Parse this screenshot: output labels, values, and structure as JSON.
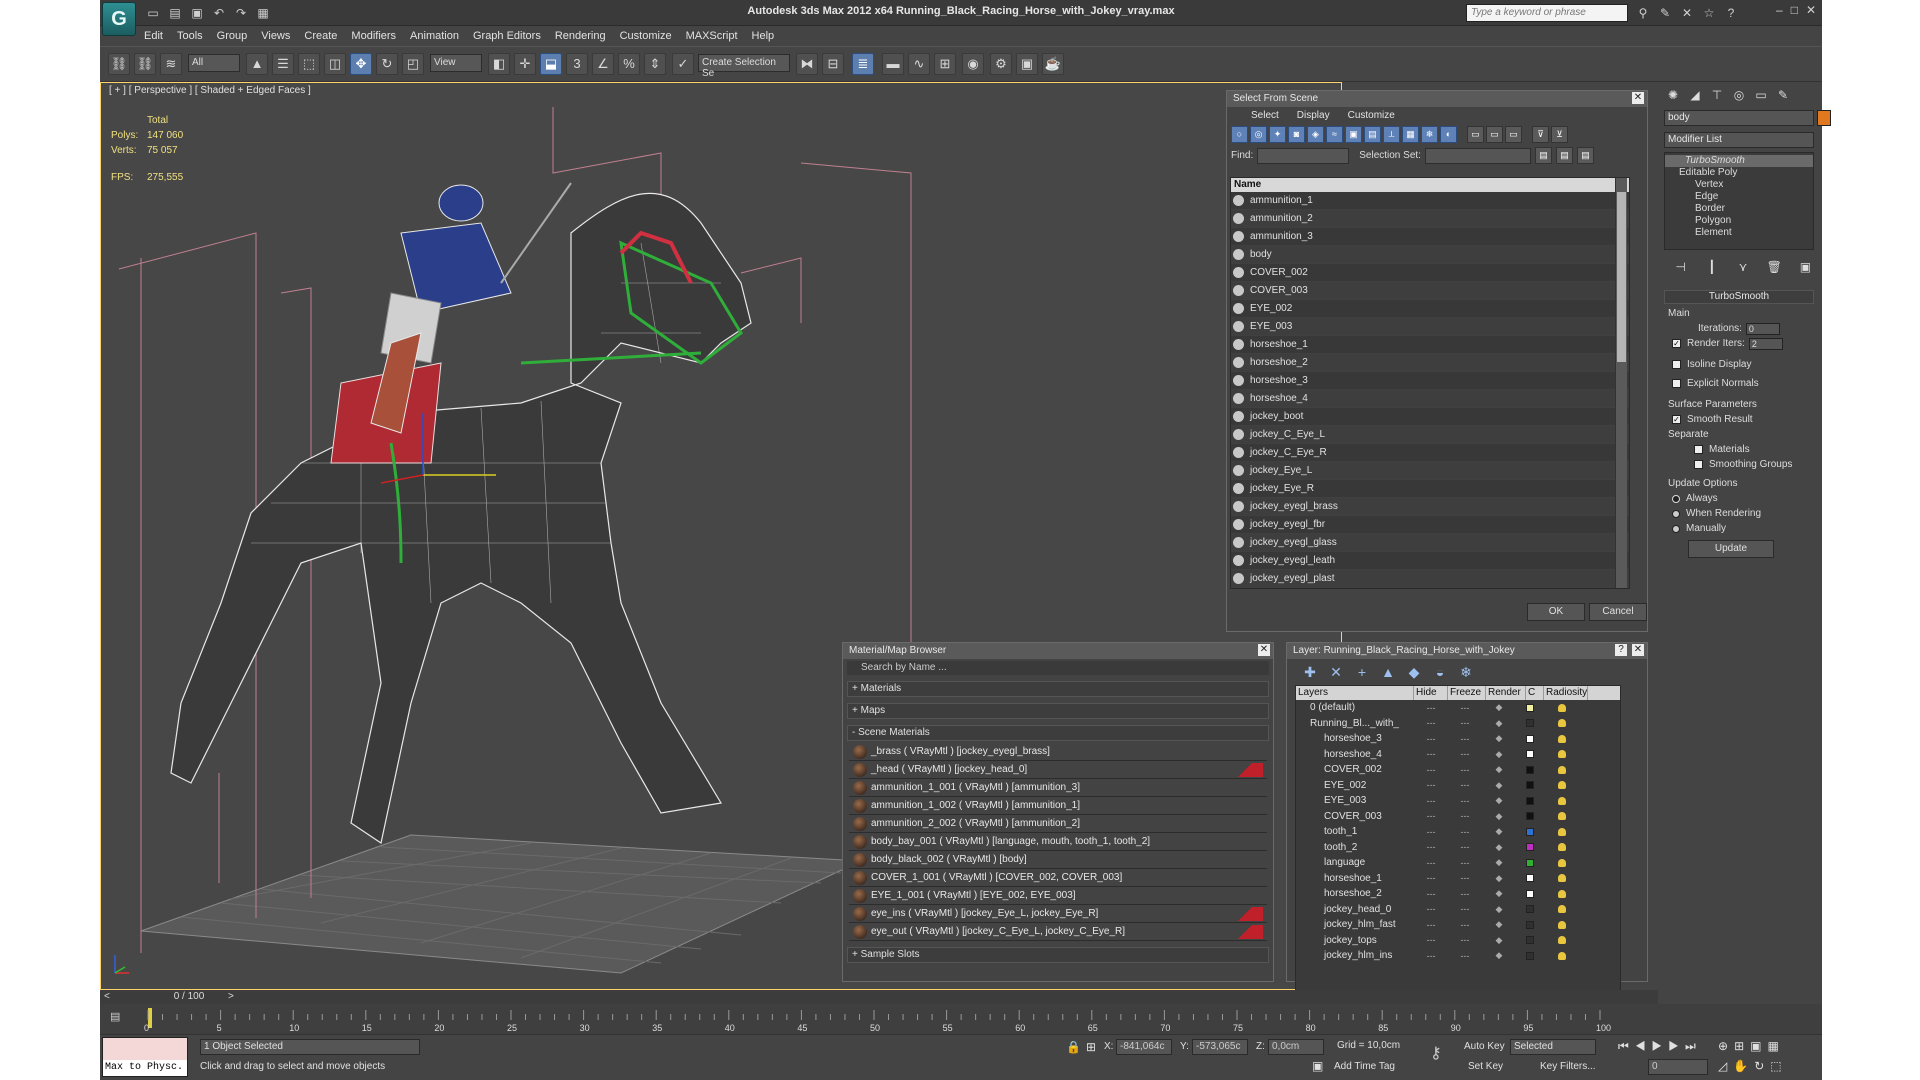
{
  "window": {
    "title": "Autodesk 3ds Max  2012 x64      Running_Black_Racing_Horse_with_Jokey_vray.max",
    "search_placeholder": "Type a keyword or phrase",
    "logo": "G"
  },
  "menu": [
    "Edit",
    "Tools",
    "Group",
    "Views",
    "Create",
    "Modifiers",
    "Animation",
    "Graph Editors",
    "Rendering",
    "Customize",
    "MAXScript",
    "Help"
  ],
  "toolbar": {
    "selection_filter": "All",
    "ref_coord": "View",
    "named_selection": "Create Selection Se"
  },
  "viewport": {
    "label": "[ + ] [ Perspective ] [ Shaded + Edged Faces ]",
    "stats": {
      "total_label": "Total",
      "polys_label": "Polys:",
      "polys_value": "147 060",
      "verts_label": "Verts:",
      "verts_value": "75 057",
      "fps_label": "FPS:",
      "fps_value": "275,555"
    }
  },
  "select_from_scene": {
    "title": "Select From Scene",
    "menu": [
      "Select",
      "Display",
      "Customize"
    ],
    "find_label": "Find:",
    "selection_set_label": "Selection Set:",
    "column_name": "Name",
    "items": [
      "ammunition_1",
      "ammunition_2",
      "ammunition_3",
      "body",
      "COVER_002",
      "COVER_003",
      "EYE_002",
      "EYE_003",
      "horseshoe_1",
      "horseshoe_2",
      "horseshoe_3",
      "horseshoe_4",
      "jockey_boot",
      "jockey_C_Eye_L",
      "jockey_C_Eye_R",
      "jockey_Eye_L",
      "jockey_Eye_R",
      "jockey_eyegl_brass",
      "jockey_eyegl_fbr",
      "jockey_eyegl_glass",
      "jockey_eyegl_leath",
      "jockey_eyegl_plast"
    ],
    "ok": "OK",
    "cancel": "Cancel"
  },
  "material_browser": {
    "title": "Material/Map Browser",
    "search_placeholder": "Search by Name ...",
    "section_materials": "+ Materials",
    "section_maps": "+ Maps",
    "section_scene": "- Scene Materials",
    "section_slots": "+ Sample Slots",
    "items": [
      "_brass  ( VRayMtl ) [jockey_eyegl_brass]",
      "_head  ( VRayMtl ) [jockey_head_0]",
      "ammunition_1_001  ( VRayMtl ) [ammunition_3]",
      "ammunition_1_002  ( VRayMtl ) [ammunition_1]",
      "ammunition_2_002  ( VRayMtl ) [ammunition_2]",
      "body_bay_001  ( VRayMtl ) [language, mouth, tooth_1, tooth_2]",
      "body_black_002  ( VRayMtl ) [body]",
      "COVER_1_001  ( VRayMtl ) [COVER_002, COVER_003]",
      "EYE_1_001  ( VRayMtl ) [EYE_002, EYE_003]",
      "eye_ins  ( VRayMtl ) [jockey_Eye_L, jockey_Eye_R]",
      "eye_out  ( VRayMtl ) [jockey_C_Eye_L, jockey_C_Eye_R]"
    ]
  },
  "layer_manager": {
    "title": "Layer: Running_Black_Racing_Horse_with_Jokey",
    "help": "?",
    "columns": [
      "Layers",
      "Hide",
      "Freeze",
      "Render",
      "C",
      "Radiosity"
    ],
    "rows": [
      {
        "name": "0 (default)",
        "color": "#f0f0a0"
      },
      {
        "name": "Running_Bl..._with_",
        "color": "#303030"
      },
      {
        "name": "horseshoe_3",
        "color": "#ffffff"
      },
      {
        "name": "horseshoe_4",
        "color": "#ffffff"
      },
      {
        "name": "COVER_002",
        "color": "#101010"
      },
      {
        "name": "EYE_002",
        "color": "#101010"
      },
      {
        "name": "EYE_003",
        "color": "#101010"
      },
      {
        "name": "COVER_003",
        "color": "#101010"
      },
      {
        "name": "tooth_1",
        "color": "#3070d0"
      },
      {
        "name": "tooth_2",
        "color": "#c030c0"
      },
      {
        "name": "language",
        "color": "#30b030"
      },
      {
        "name": "horseshoe_1",
        "color": "#ffffff"
      },
      {
        "name": "horseshoe_2",
        "color": "#ffffff"
      },
      {
        "name": "jockey_head_0",
        "color": "#303030"
      },
      {
        "name": "jockey_hlm_fast",
        "color": "#303030"
      },
      {
        "name": "jockey_tops",
        "color": "#303030"
      },
      {
        "name": "jockey_hlm_ins",
        "color": "#303030"
      }
    ]
  },
  "command_panel": {
    "object_name": "body",
    "modifier_list": "Modifier List",
    "stack": [
      "TurboSmooth",
      "Editable Poly",
      "Vertex",
      "Edge",
      "Border",
      "Polygon",
      "Element"
    ],
    "turbosmooth_title": "TurboSmooth",
    "main_label": "Main",
    "iterations_label": "Iterations:",
    "iterations_value": "0",
    "render_iters_label": "Render Iters:",
    "render_iters_value": "2",
    "isoline": "Isoline Display",
    "explicit_normals": "Explicit Normals",
    "surface_params": "Surface Parameters",
    "smooth_result": "Smooth Result",
    "separate": "Separate",
    "materials": "Materials",
    "smoothing_groups": "Smoothing Groups",
    "update_options": "Update Options",
    "always": "Always",
    "when_rendering": "When Rendering",
    "manually": "Manually",
    "update_btn": "Update"
  },
  "timeline": {
    "frame": "0 / 100",
    "ticks": [
      "0",
      "5",
      "10",
      "15",
      "20",
      "25",
      "30",
      "35",
      "40",
      "45",
      "50",
      "55",
      "60",
      "65",
      "70",
      "75",
      "80",
      "85",
      "90",
      "95",
      "100"
    ]
  },
  "status": {
    "maxscript": "Max to Physc.",
    "selected": "1 Object Selected",
    "prompt": "Click and drag to select and move objects",
    "x_label": "X:",
    "x_value": "-841,064c",
    "y_label": "Y:",
    "y_value": "-573,065c",
    "z_label": "Z:",
    "z_value": "0,0cm",
    "grid": "Grid = 10,0cm",
    "add_time_tag": "Add Time Tag",
    "auto_key": "Auto Key",
    "set_key": "Set Key",
    "key_filters": "Key Filters...",
    "selected_dropdown": "Selected",
    "frame_field": "0"
  }
}
